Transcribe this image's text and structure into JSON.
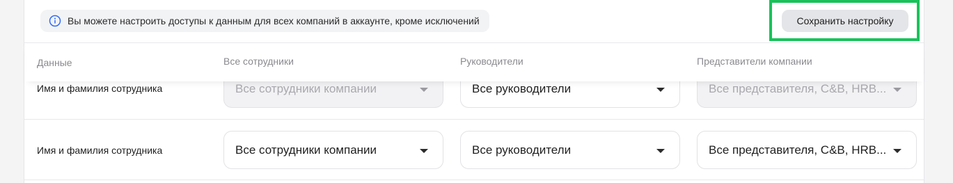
{
  "banner": {
    "info_text": "Вы можете настроить доступы к данным для всех компаний в аккаунте, кроме исключений",
    "save_label": "Сохранить настройку"
  },
  "table": {
    "columns": [
      "Данные",
      "Все сотрудники",
      "Руководители",
      "Представители компании"
    ],
    "rows": [
      {
        "label": "Имя и фамилия сотрудника",
        "disabled": true,
        "employees": "Все сотрудники компании",
        "managers": "Все руководители",
        "representatives": "Все представителя, C&B, HRB..."
      },
      {
        "label": "Имя и фамилия сотрудника",
        "disabled": false,
        "employees": "Все сотрудники компании",
        "managers": "Все руководители",
        "representatives": "Все представителя, C&B, HRB..."
      }
    ]
  },
  "icons": {
    "info": "info-circle-icon",
    "caret": "caret-down-icon"
  },
  "colors": {
    "highlight": "#19c25a",
    "info_icon": "#2f6bff",
    "button_bg": "#e4e5e8"
  }
}
